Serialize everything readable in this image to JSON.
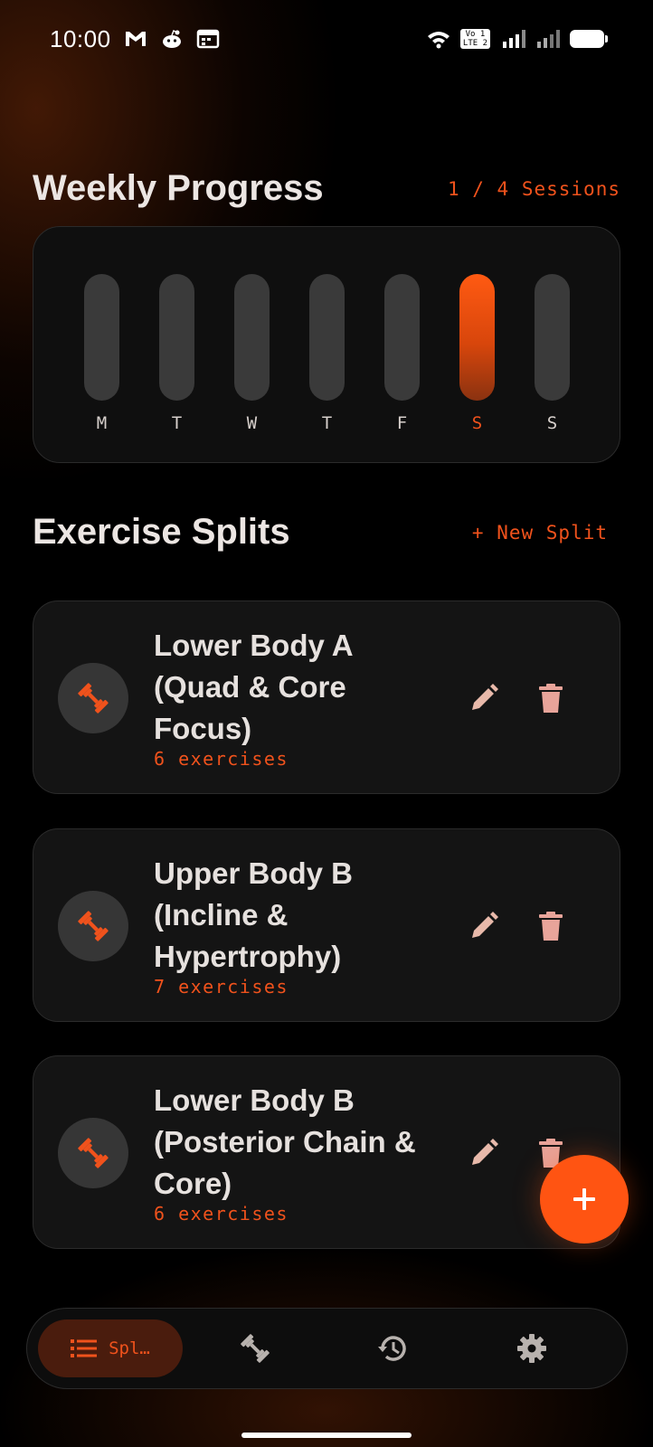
{
  "status_bar": {
    "time": "10:00",
    "icons_left": [
      "gmail-icon",
      "reddit-icon",
      "calendar-icon"
    ],
    "icons_right": [
      "wifi-icon",
      "volte-icon",
      "signal-icon",
      "signal-icon",
      "battery-icon"
    ],
    "volte_text": "Vo LTE 1 2"
  },
  "weekly_progress": {
    "title": "Weekly Progress",
    "sessions": "1 / 4 Sessions",
    "days": [
      {
        "label": "M",
        "done": false
      },
      {
        "label": "T",
        "done": false
      },
      {
        "label": "W",
        "done": false
      },
      {
        "label": "T",
        "done": false
      },
      {
        "label": "F",
        "done": false
      },
      {
        "label": "S",
        "done": true
      },
      {
        "label": "S",
        "done": false
      }
    ],
    "accent_color": "#f0521c"
  },
  "splits_section": {
    "title": "Exercise Splits",
    "new_split_label": "+ New Split"
  },
  "splits": [
    {
      "name": "Lower Body A (Quad & Core Focus)",
      "count": "6 exercises",
      "icon": "dumbbell-icon"
    },
    {
      "name": "Upper Body B (Incline & Hypertrophy)",
      "count": "7 exercises",
      "icon": "dumbbell-icon"
    },
    {
      "name": "Lower Body B (Posterior Chain & Core)",
      "count": "6 exercises",
      "icon": "dumbbell-icon"
    }
  ],
  "fab": {
    "icon": "plus-icon"
  },
  "bottom_nav": {
    "items": [
      {
        "label": "Spl…",
        "icon": "list-icon",
        "active": true
      },
      {
        "label": "",
        "icon": "dumbbell-icon",
        "active": false
      },
      {
        "label": "",
        "icon": "history-icon",
        "active": false
      },
      {
        "label": "",
        "icon": "gear-icon",
        "active": false
      }
    ]
  }
}
